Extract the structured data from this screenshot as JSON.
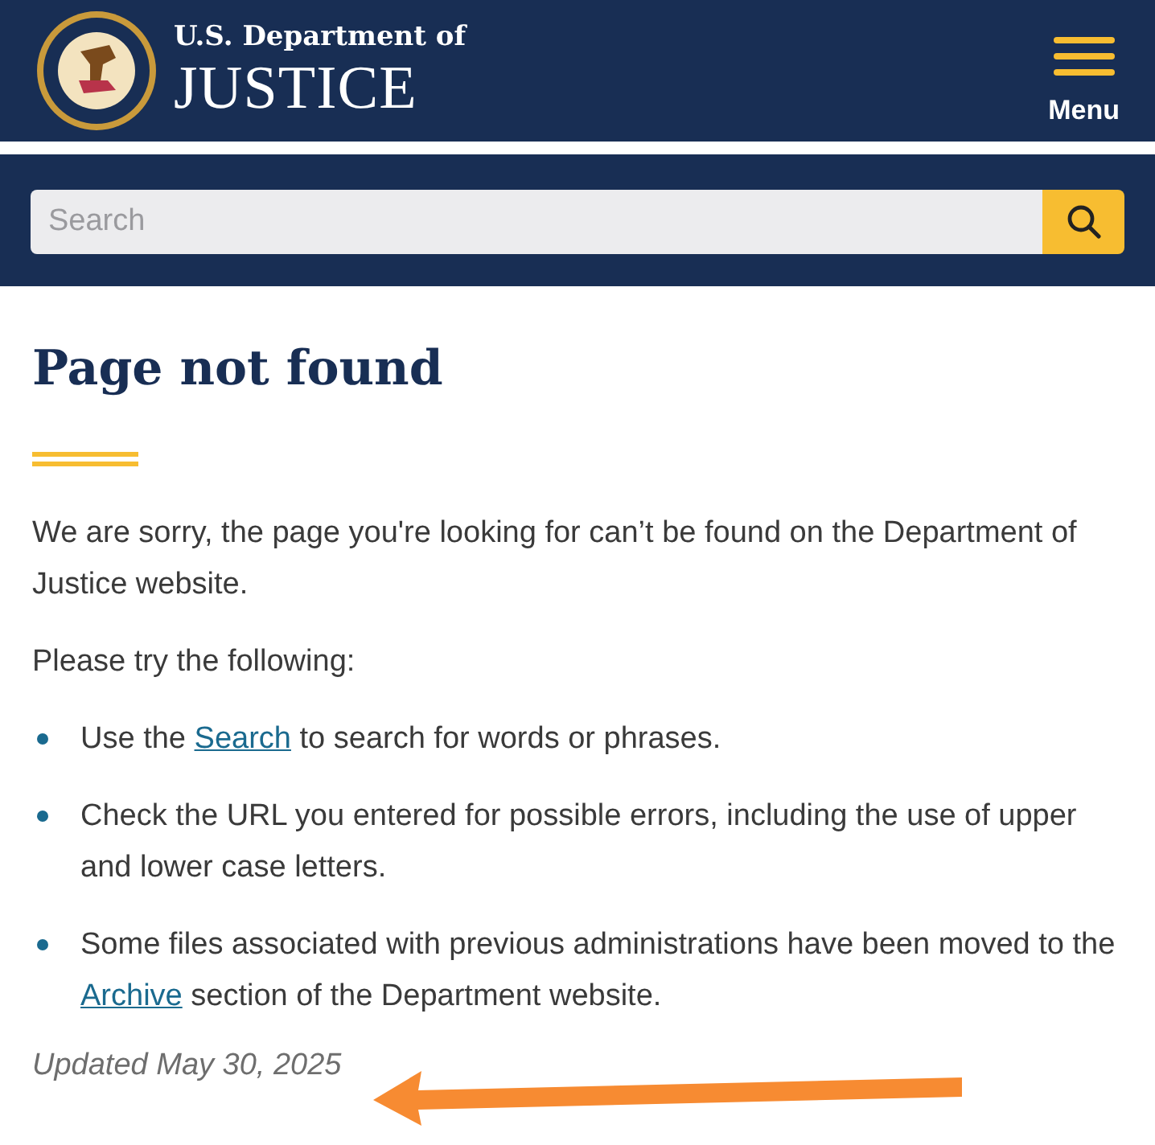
{
  "header": {
    "agency_line": "U.S. Department of",
    "agency_name": "JUSTICE",
    "menu_label": "Menu"
  },
  "search": {
    "placeholder": "Search"
  },
  "page": {
    "title": "Page not found",
    "intro": "We are sorry, the page you're looking for can’t be found on the Department of Justice website.",
    "lead": "Please try the following:",
    "bullets": [
      {
        "before": "Use the ",
        "link": "Search",
        "after": " to search for words or phrases."
      },
      {
        "before": "Check the URL you entered for possible errors, including the use of upper and lower case letters."
      },
      {
        "before": "Some files associated with previous administrations have been moved to the ",
        "link": "Archive",
        "after": " section of the Department website."
      }
    ],
    "updated": "Updated May 30, 2025"
  }
}
